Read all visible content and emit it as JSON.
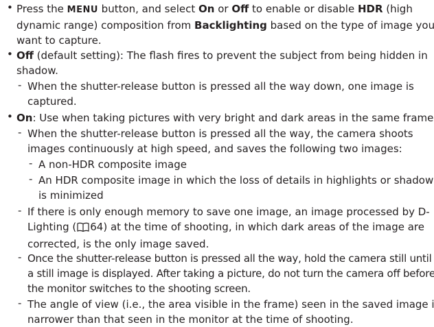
{
  "page": {
    "bullet_symbol": "•",
    "dash_symbol": "-",
    "p1": {
      "a": "Press the ",
      "menu": "MENU",
      "b": " button, and select ",
      "on": "On",
      "c": " or ",
      "off": "Off",
      "d": " to enable or disable ",
      "hdr": "HDR",
      "e": " (high",
      "l2a": "dynamic range) composition from ",
      "backlighting": "Backlighting",
      "l2b": " based on the type of image you",
      "l3": "want to capture."
    },
    "p2": {
      "off": "Off",
      "a": " (default setting): The flash fires to prevent the subject from being hidden in",
      "l2": "shadow."
    },
    "p2s1": {
      "l1": "When the shutter-release button is pressed all the way down, one image is",
      "l2": "captured."
    },
    "p3": {
      "on": "On",
      "a": ": Use when taking pictures with very bright and dark areas in the same frame."
    },
    "p3s1": {
      "l1": "When the shutter-release button is pressed all the way, the camera shoots",
      "l2": "images continuously at high speed, and saves the following two images:"
    },
    "p3s1a": "A non-HDR composite image",
    "p3s1b": {
      "l1": "An HDR composite image in which the loss of details in highlights or shadows",
      "l2": "is minimized"
    },
    "p3s2": {
      "l1": "If there is only enough memory to save one image, an image processed by D-",
      "l2a": "Lighting (",
      "l2page": "64",
      "l2b": ") at the time of shooting, in which dark areas of the image are",
      "l3": "corrected, is the only image saved."
    },
    "p3s3": {
      "l1": "Once the shutter-release button is pressed all the way, hold the camera still until",
      "l2": "a still image is displayed. After taking a picture, do not turn the camera off before",
      "l3": "the monitor switches to the shooting screen."
    },
    "p3s4": {
      "l1": "The angle of view (i.e., the area visible in the frame) seen in the saved image is",
      "l2": "narrower than that seen in the monitor at the time of shooting."
    }
  }
}
